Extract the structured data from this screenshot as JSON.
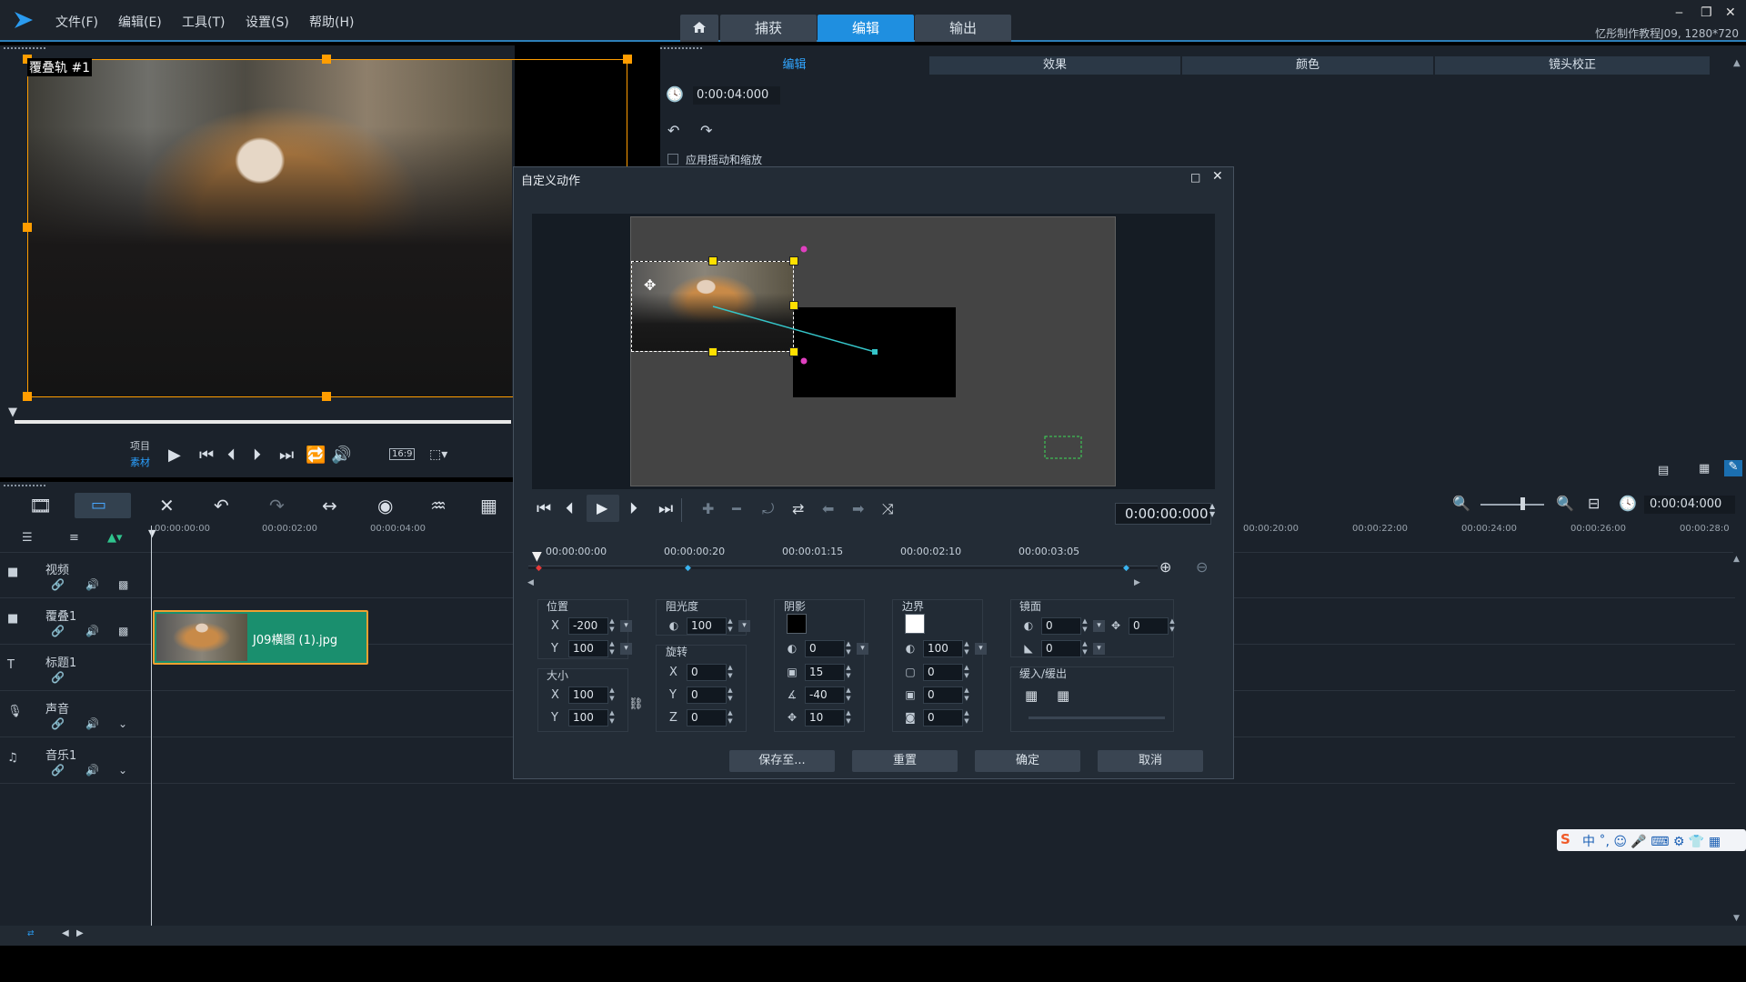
{
  "menubar": {
    "logo_icon": "play-logo-icon",
    "items": [
      "文件(F)",
      "编辑(E)",
      "工具(T)",
      "设置(S)",
      "帮助(H)"
    ],
    "workspace_tabs": [
      {
        "label": "",
        "icon": "home-icon"
      },
      {
        "label": "捕获"
      },
      {
        "label": "编辑",
        "active": true
      },
      {
        "label": "输出"
      }
    ],
    "project_info": "忆彤制作教程J09, 1280*720",
    "accent": "#1f8fe0"
  },
  "preview": {
    "overlay_label": "覆叠轨 #1",
    "mode_project": "项目",
    "mode_clip": "素材",
    "aspect": "16:9"
  },
  "right_panel": {
    "tabs": [
      "编辑",
      "效果",
      "颜色",
      "镜头校正"
    ],
    "duration": "0:00:04:000",
    "pan_zoom_label": "应用摇动和缩放"
  },
  "timeline": {
    "time_display": "0:00:04:000",
    "ruler": [
      "00:00:00:00",
      "00:00:02:00",
      "00:00:04:00",
      "00:00:20:00",
      "00:00:22:00",
      "00:00:24:00",
      "00:00:26:00",
      "00:00:28:0"
    ],
    "tracks": [
      {
        "name": "视频",
        "icon": "video-track-icon"
      },
      {
        "name": "覆叠1",
        "icon": "overlay-track-icon"
      },
      {
        "name": "标题1",
        "icon": "title-track-icon"
      },
      {
        "name": "声音",
        "icon": "voice-track-icon"
      },
      {
        "name": "音乐1",
        "icon": "music-track-icon"
      }
    ],
    "clip_name": "J09横图 (1).jpg",
    "clip_color": "#1a8f6e"
  },
  "dialog": {
    "title": "自定义动作",
    "time": "0:00:00:000",
    "ruler": [
      "00:00:00:00",
      "00:00:00:20",
      "00:00:01:15",
      "00:00:02:10",
      "00:00:03:05"
    ],
    "groups": {
      "position": {
        "label": "位置",
        "x": "-200",
        "y": "100"
      },
      "size": {
        "label": "大小",
        "x": "100",
        "y": "100"
      },
      "opacity": {
        "label": "阻光度",
        "value": "100"
      },
      "rotation": {
        "label": "旋转",
        "x": "0",
        "y": "0",
        "z": "0"
      },
      "shadow": {
        "label": "阴影",
        "opacity": "0",
        "blur": "15",
        "angle": "-40",
        "distance": "10"
      },
      "border": {
        "label": "边界",
        "opacity": "100",
        "width": "0",
        "v2": "0",
        "v3": "0"
      },
      "mirror": {
        "label": "镜面",
        "opacity": "0",
        "offset": "0",
        "v2": "0"
      },
      "fade": {
        "label": "缓入/缓出"
      }
    },
    "buttons": {
      "save": "保存至...",
      "reset": "重置",
      "ok": "确定",
      "cancel": "取消"
    }
  }
}
